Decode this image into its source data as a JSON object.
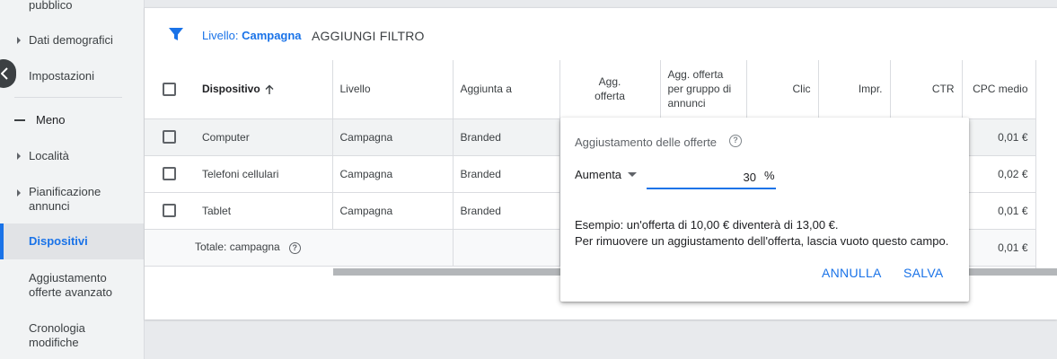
{
  "sidebar": {
    "items_top": [
      {
        "label": "pubblico",
        "caret": false
      },
      {
        "label": "Dati demografici",
        "caret": true
      },
      {
        "label": "Impostazioni",
        "caret": false
      }
    ],
    "minus_label": "Meno",
    "items_bottom": [
      {
        "label": "Località",
        "caret": true
      },
      {
        "label": "Pianificazione annunci",
        "caret": true
      },
      {
        "label": "Dispositivi",
        "caret": false,
        "active": true
      },
      {
        "label": "Aggiustamento offerte avanzato",
        "caret": false
      },
      {
        "label": "Cronologia modifiche",
        "caret": false
      }
    ]
  },
  "filter_bar": {
    "level_prefix": "Livello: ",
    "level_value": "Campagna",
    "add_filter": "AGGIUNGI FILTRO"
  },
  "table": {
    "headers": {
      "device": "Dispositivo",
      "level": "Livello",
      "added_to": "Aggiunta a",
      "bid_adj": "Agg. offerta",
      "bid_adj_group": "Agg. offerta per gruppo di annunci",
      "clicks": "Clic",
      "impr": "Impr.",
      "ctr": "CTR",
      "avg_cpc": "CPC medio"
    },
    "rows": [
      {
        "device": "Computer",
        "level": "Campagna",
        "added_to": "Branded",
        "avg_cpc": "0,01 €"
      },
      {
        "device": "Telefoni cellulari",
        "level": "Campagna",
        "added_to": "Branded",
        "avg_cpc": "0,02 €"
      },
      {
        "device": "Tablet",
        "level": "Campagna",
        "added_to": "Branded",
        "avg_cpc": "0,01 €"
      }
    ],
    "total": {
      "label": "Totale: campagna",
      "avg_cpc": "0,01 €"
    }
  },
  "popup": {
    "title": "Aggiustamento delle offerte",
    "select_value": "Aumenta",
    "input_value": "30",
    "percent_sign": "%",
    "example_line1": "Esempio: un'offerta di 10,00 € diventerà di 13,00 €.",
    "example_line2": "Per rimuovere un aggiustamento dell'offerta, lascia vuoto questo campo.",
    "cancel": "ANNULLA",
    "save": "SALVA"
  },
  "colors": {
    "accent": "#1a73e8",
    "sidebar_bg": "#f1f3f4"
  }
}
